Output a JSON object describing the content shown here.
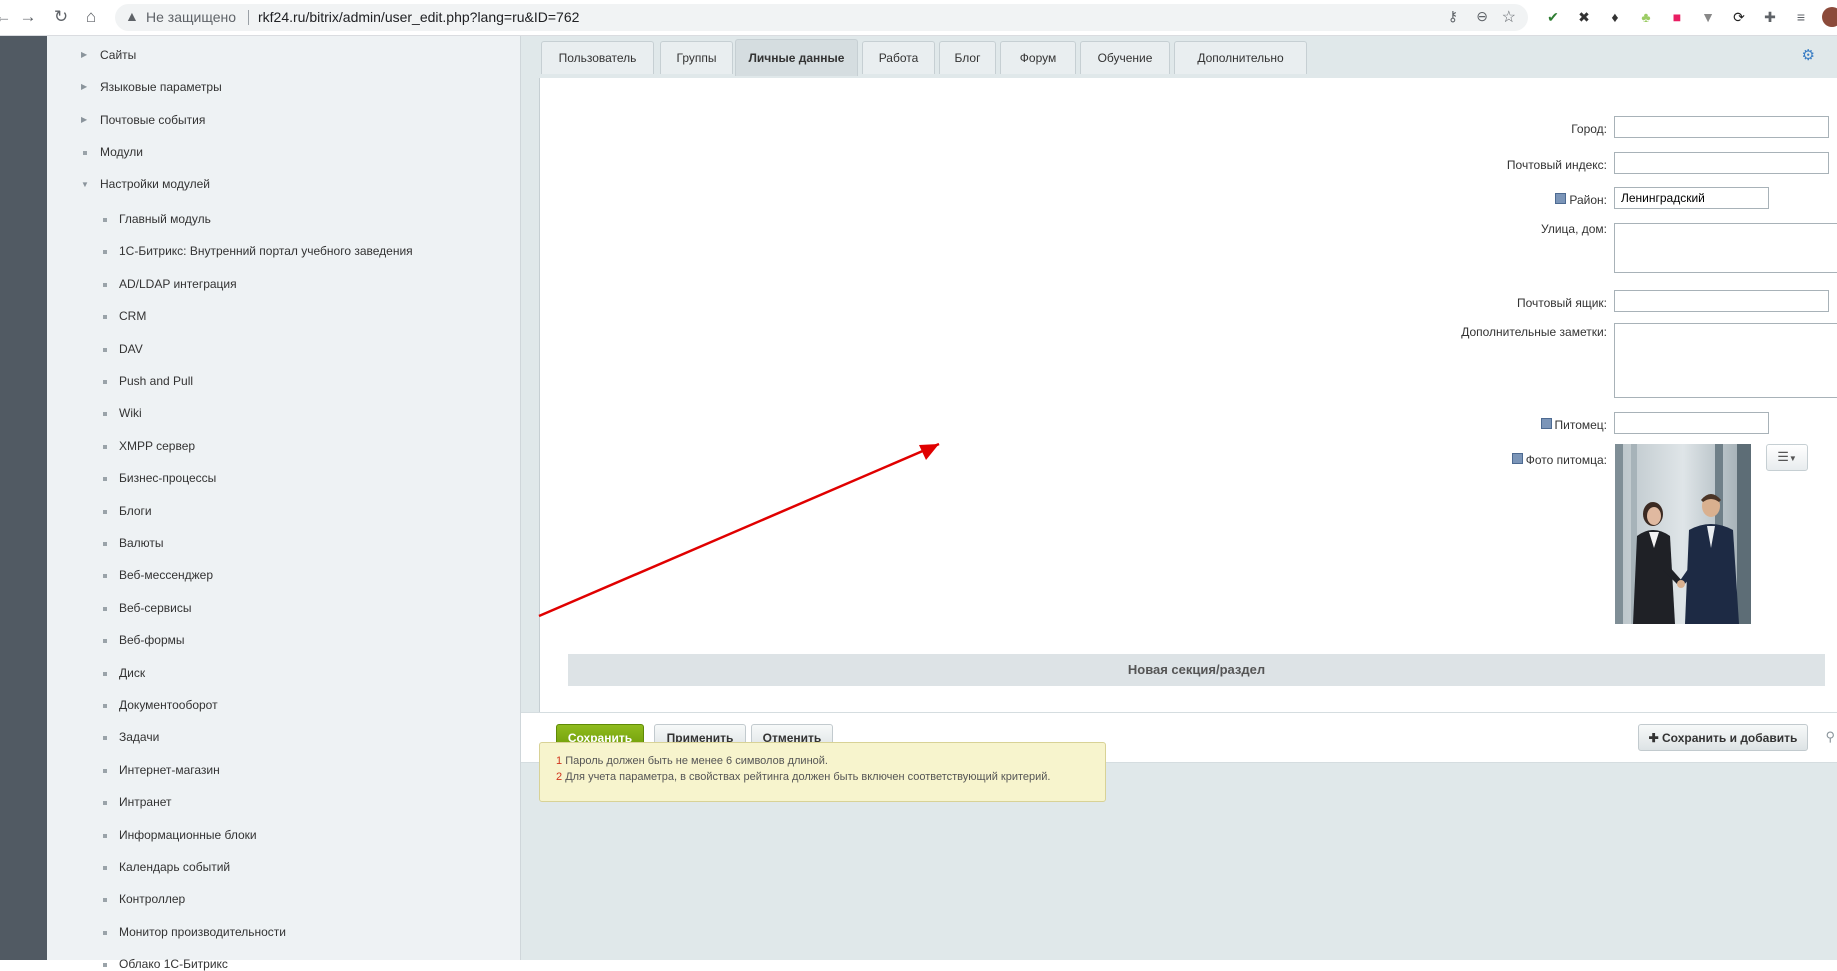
{
  "browser": {
    "security_text": "Не защищено",
    "url": "rkf24.ru/bitrix/admin/user_edit.php?lang=ru&ID=762"
  },
  "sidebar": {
    "top_items": [
      {
        "label": "Сайты"
      },
      {
        "label": "Языковые параметры"
      },
      {
        "label": "Почтовые события"
      },
      {
        "label": "Модули"
      },
      {
        "label": "Настройки модулей"
      }
    ],
    "sub_items": [
      {
        "label": "Главный модуль"
      },
      {
        "label": "1С-Битрикс: Внутренний портал учебного заведения"
      },
      {
        "label": "AD/LDAP интеграция"
      },
      {
        "label": "CRM"
      },
      {
        "label": "DAV"
      },
      {
        "label": "Push and Pull"
      },
      {
        "label": "Wiki"
      },
      {
        "label": "XMPP сервер"
      },
      {
        "label": "Бизнес-процессы"
      },
      {
        "label": "Блоги"
      },
      {
        "label": "Валюты"
      },
      {
        "label": "Веб-мессенджер"
      },
      {
        "label": "Веб-сервисы"
      },
      {
        "label": "Веб-формы"
      },
      {
        "label": "Диск"
      },
      {
        "label": "Документооборот"
      },
      {
        "label": "Задачи"
      },
      {
        "label": "Интернет-магазин"
      },
      {
        "label": "Интранет"
      },
      {
        "label": "Информационные блоки"
      },
      {
        "label": "Календарь событий"
      },
      {
        "label": "Контроллер"
      },
      {
        "label": "Монитор производительности"
      },
      {
        "label": "Облако 1С-Битрикс"
      }
    ]
  },
  "tabs": [
    {
      "label": "Пользователь"
    },
    {
      "label": "Группы"
    },
    {
      "label": "Личные данные"
    },
    {
      "label": "Работа"
    },
    {
      "label": "Блог"
    },
    {
      "label": "Форум"
    },
    {
      "label": "Обучение"
    },
    {
      "label": "Дополнительно"
    }
  ],
  "form": {
    "city_label": "Город:",
    "city_value": "",
    "zip_label": "Почтовый индекс:",
    "zip_value": "",
    "district_label": "Район:",
    "district_value": "Ленинградский",
    "street_label": "Улица, дом:",
    "pobox_label": "Почтовый ящик:",
    "pobox_value": "",
    "notes_label": "Дополнительные заметки:",
    "pet_label": "Питомец:",
    "pet_value": "",
    "pet_photo_label": "Фото питомца:",
    "new_section_label": "Новая секция/раздел"
  },
  "buttons": {
    "save": "Сохранить",
    "apply": "Применить",
    "cancel": "Отменить",
    "save_add": "Сохранить и добавить"
  },
  "notes": [
    {
      "num": "1",
      "text": "Пароль должен быть не менее 6 символов длиной."
    },
    {
      "num": "2",
      "text": "Для учета параметра, в свойствах рейтинга должен быть включен соответствующий критерий."
    }
  ],
  "colors": {
    "accent_save": "#7aa80e",
    "arrow": "#e00000"
  }
}
